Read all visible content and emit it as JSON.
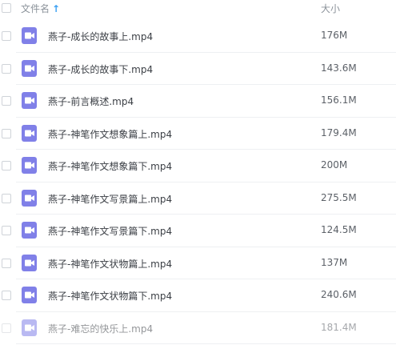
{
  "header": {
    "name_label": "文件名",
    "size_label": "大小",
    "sort_icon": "arrow-up-icon"
  },
  "files": [
    {
      "name": "燕子-成长的故事上.mp4",
      "size": "176M"
    },
    {
      "name": "燕子-成长的故事下.mp4",
      "size": "143.6M"
    },
    {
      "name": "燕子-前言概述.mp4",
      "size": "156.1M"
    },
    {
      "name": "燕子-神笔作文想象篇上.mp4",
      "size": "179.4M"
    },
    {
      "name": "燕子-神笔作文想象篇下.mp4",
      "size": "200M"
    },
    {
      "name": "燕子-神笔作文写景篇上.mp4",
      "size": "275.5M"
    },
    {
      "name": "燕子-神笔作文写景篇下.mp4",
      "size": "124.5M"
    },
    {
      "name": "燕子-神笔作文状物篇上.mp4",
      "size": "137M"
    },
    {
      "name": "燕子-神笔作文状物篇下.mp4",
      "size": "240.6M"
    },
    {
      "name": "燕子-难忘的快乐上.mp4",
      "size": "181.4M"
    }
  ],
  "colors": {
    "video_icon": "#8080e8",
    "sort_arrow": "#3aa0f3"
  },
  "icons": {
    "file_type": "video-icon"
  }
}
